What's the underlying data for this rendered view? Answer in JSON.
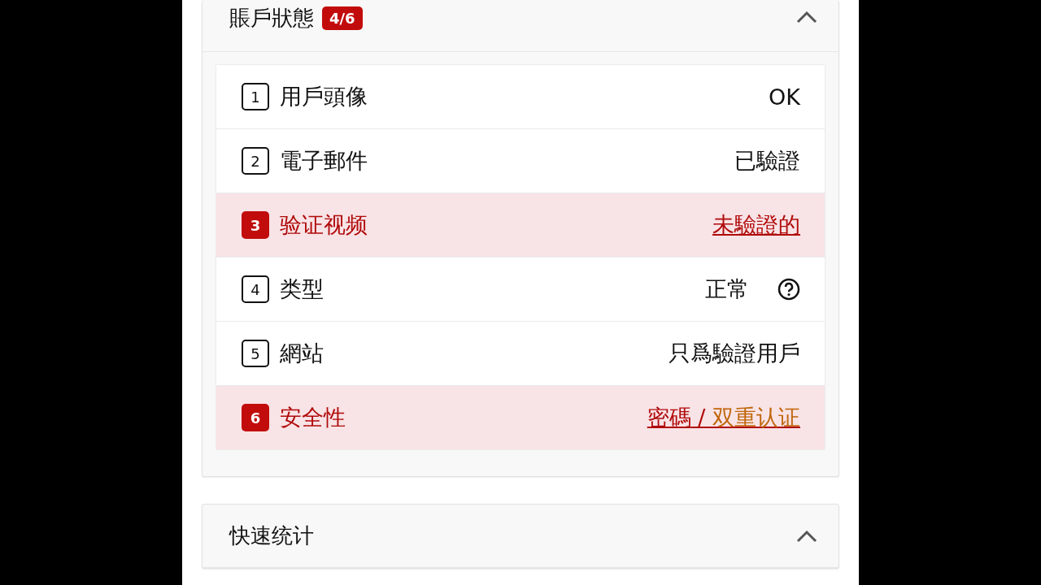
{
  "panels": [
    {
      "title": "賬戶狀態",
      "badge": "4/6",
      "expanded": true,
      "rows": [
        {
          "number": "1",
          "label": "用戶頭像",
          "failing": false,
          "help": false,
          "value": [
            {
              "text": "OK",
              "color": "#111111"
            }
          ]
        },
        {
          "number": "2",
          "label": "電子郵件",
          "failing": false,
          "help": false,
          "value": [
            {
              "text": "已驗證",
              "color": "#111111"
            }
          ]
        },
        {
          "number": "3",
          "label": "验证视频",
          "failing": true,
          "help": false,
          "value": [
            {
              "text": "未驗證的",
              "color": "#b00a0a"
            }
          ]
        },
        {
          "number": "4",
          "label": "类型",
          "failing": false,
          "help": true,
          "value": [
            {
              "text": "正常",
              "color": "#111111"
            }
          ]
        },
        {
          "number": "5",
          "label": "網站",
          "failing": false,
          "help": false,
          "value": [
            {
              "text": "只爲驗證用戶",
              "color": "#111111"
            }
          ]
        },
        {
          "number": "6",
          "label": "安全性",
          "failing": true,
          "help": false,
          "value": [
            {
              "text": "密碼",
              "color": "#b00a0a"
            },
            {
              "text": " / ",
              "color": "#b00a0a"
            },
            {
              "text": "双重认证",
              "color": "#c0650a"
            }
          ]
        }
      ]
    },
    {
      "title": "快速统计",
      "expanded": true
    }
  ]
}
